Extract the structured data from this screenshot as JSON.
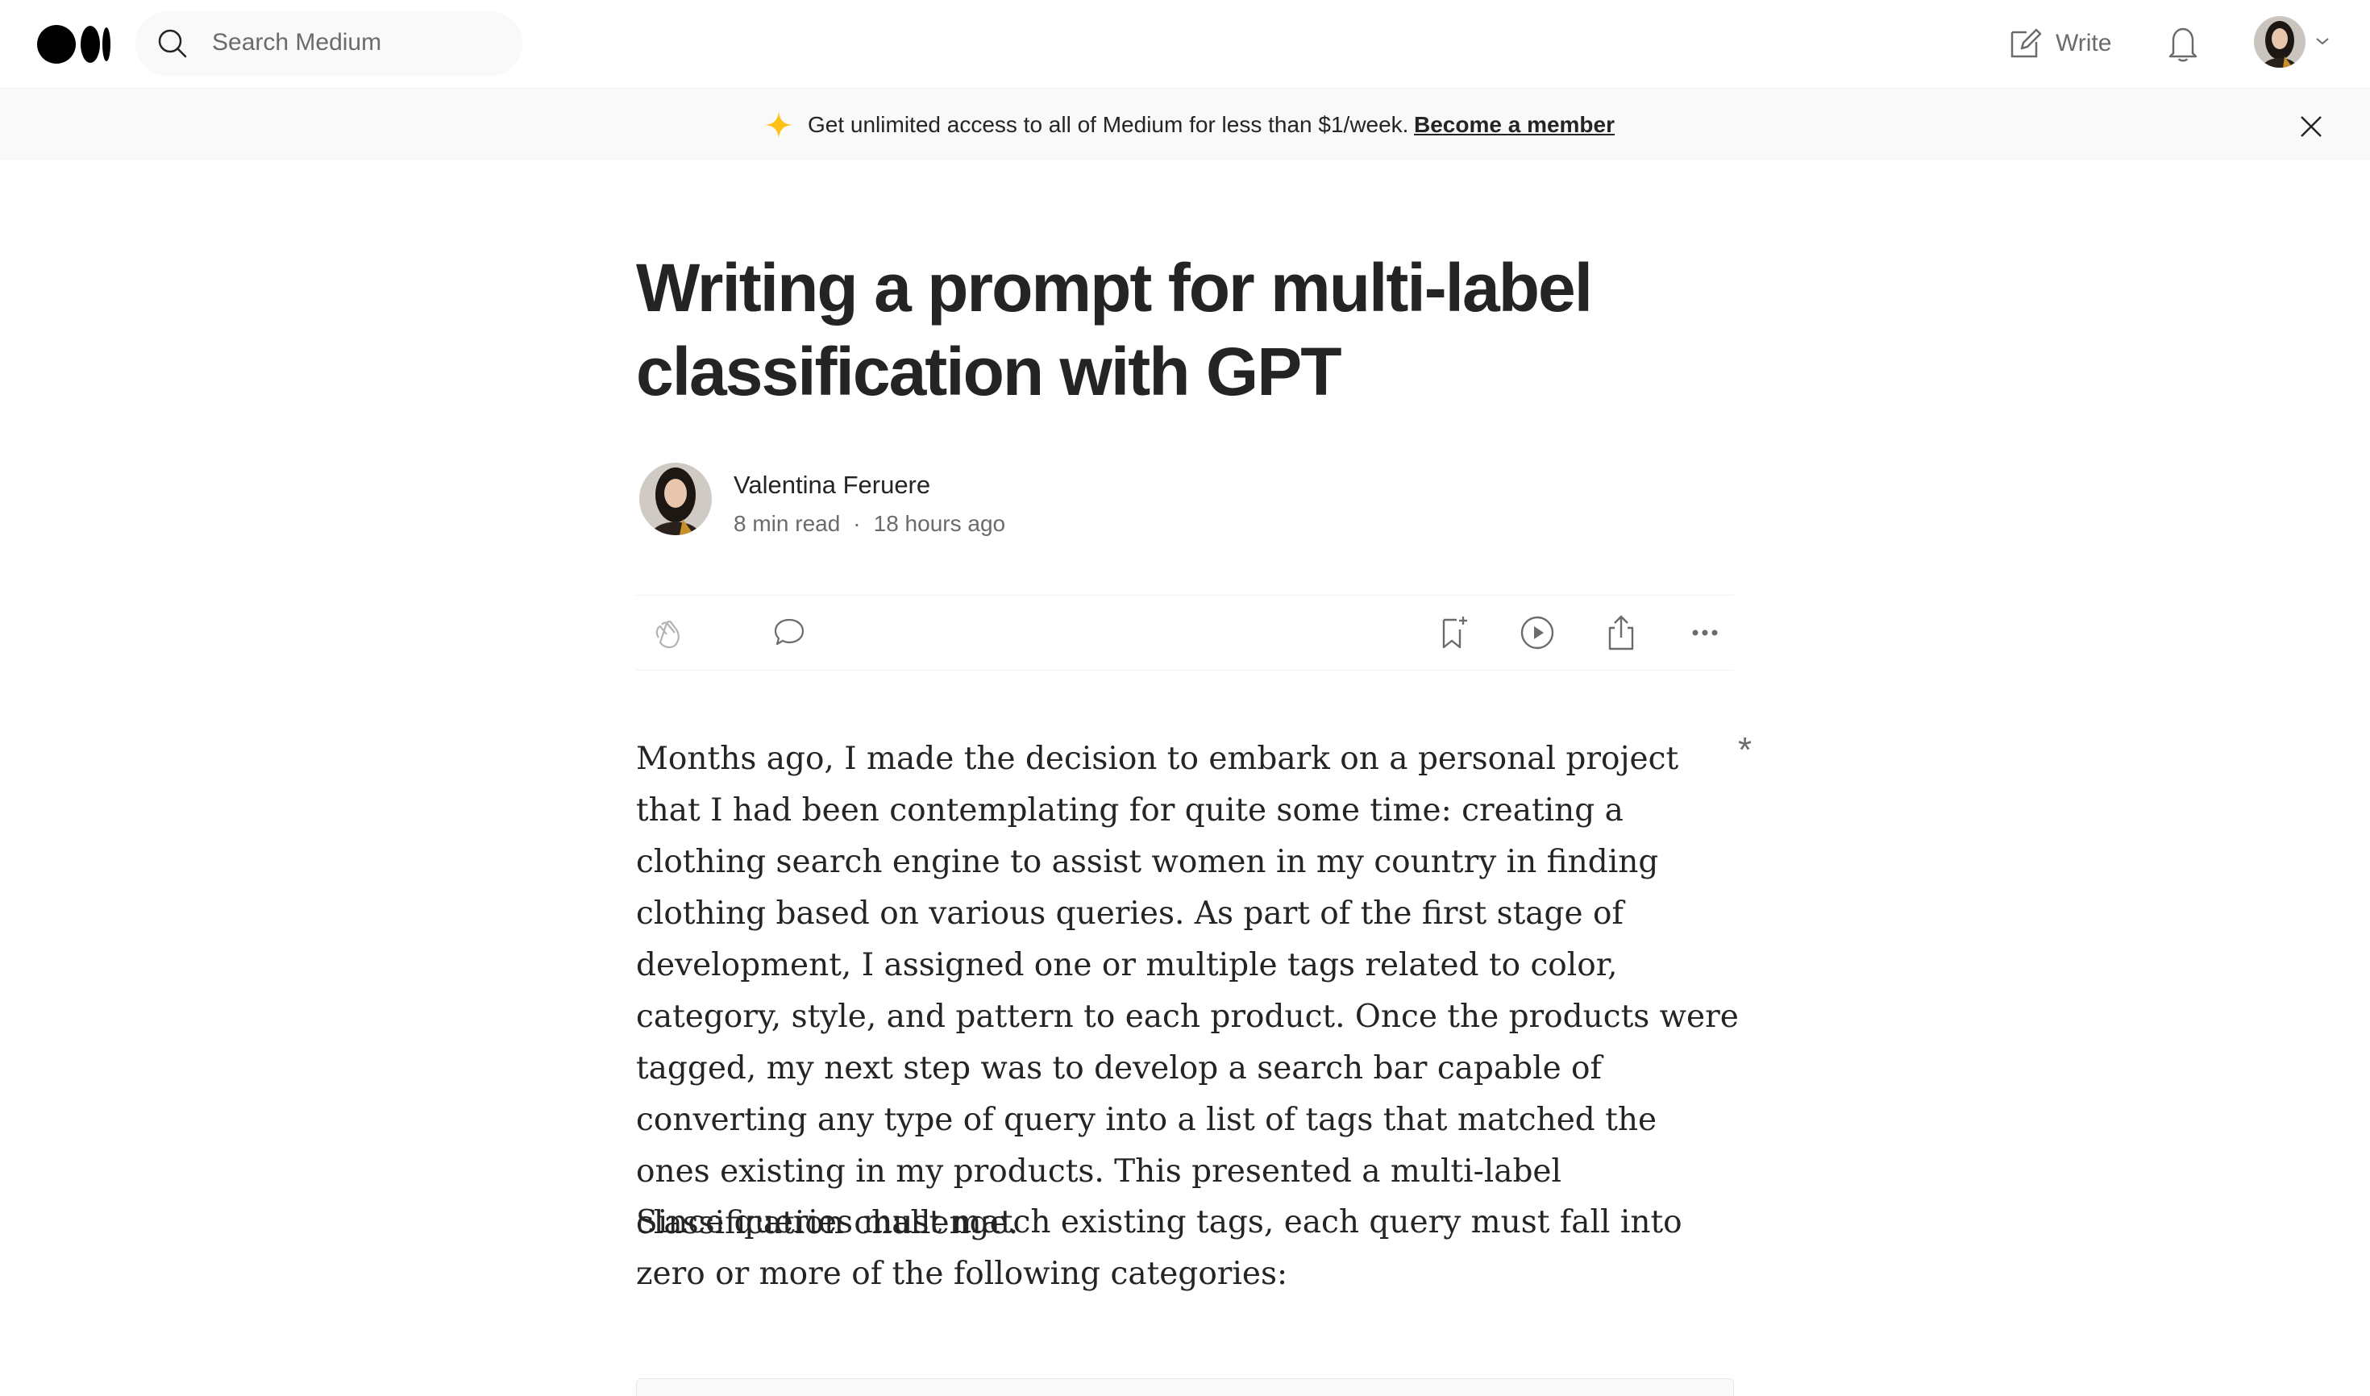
{
  "nav": {
    "search_placeholder": "Search Medium",
    "write_label": "Write"
  },
  "banner": {
    "text": "Get unlimited access to all of Medium for less than $1/week.",
    "link": "Become a member"
  },
  "article": {
    "title": "Writing a prompt for multi-label classification with GPT",
    "author": "Valentina Feruere",
    "read_time": "8 min read",
    "separator": "·",
    "published": "18 hours ago",
    "paragraphs": [
      "Months ago, I made the decision to embark on a personal project that I had been contemplating for quite some time: creating a clothing search engine to assist women in my country in finding clothing based on various queries. As part of the first stage of development, I assigned one or multiple tags related to color, category, style, and pattern to each product. Once the products were tagged, my next step was to develop a search bar capable of converting any type of query into a list of tags that matched the ones existing in my products. This presented a multi-label classification challenge.",
      "Since queries must match existing tags, each query must fall into zero or more of the following categories:"
    ],
    "margin_mark": "*"
  },
  "colors": {
    "text": "#242424",
    "muted": "#6b6b6b",
    "banner_bg": "#f9f9f9",
    "star": "#ffc017"
  }
}
